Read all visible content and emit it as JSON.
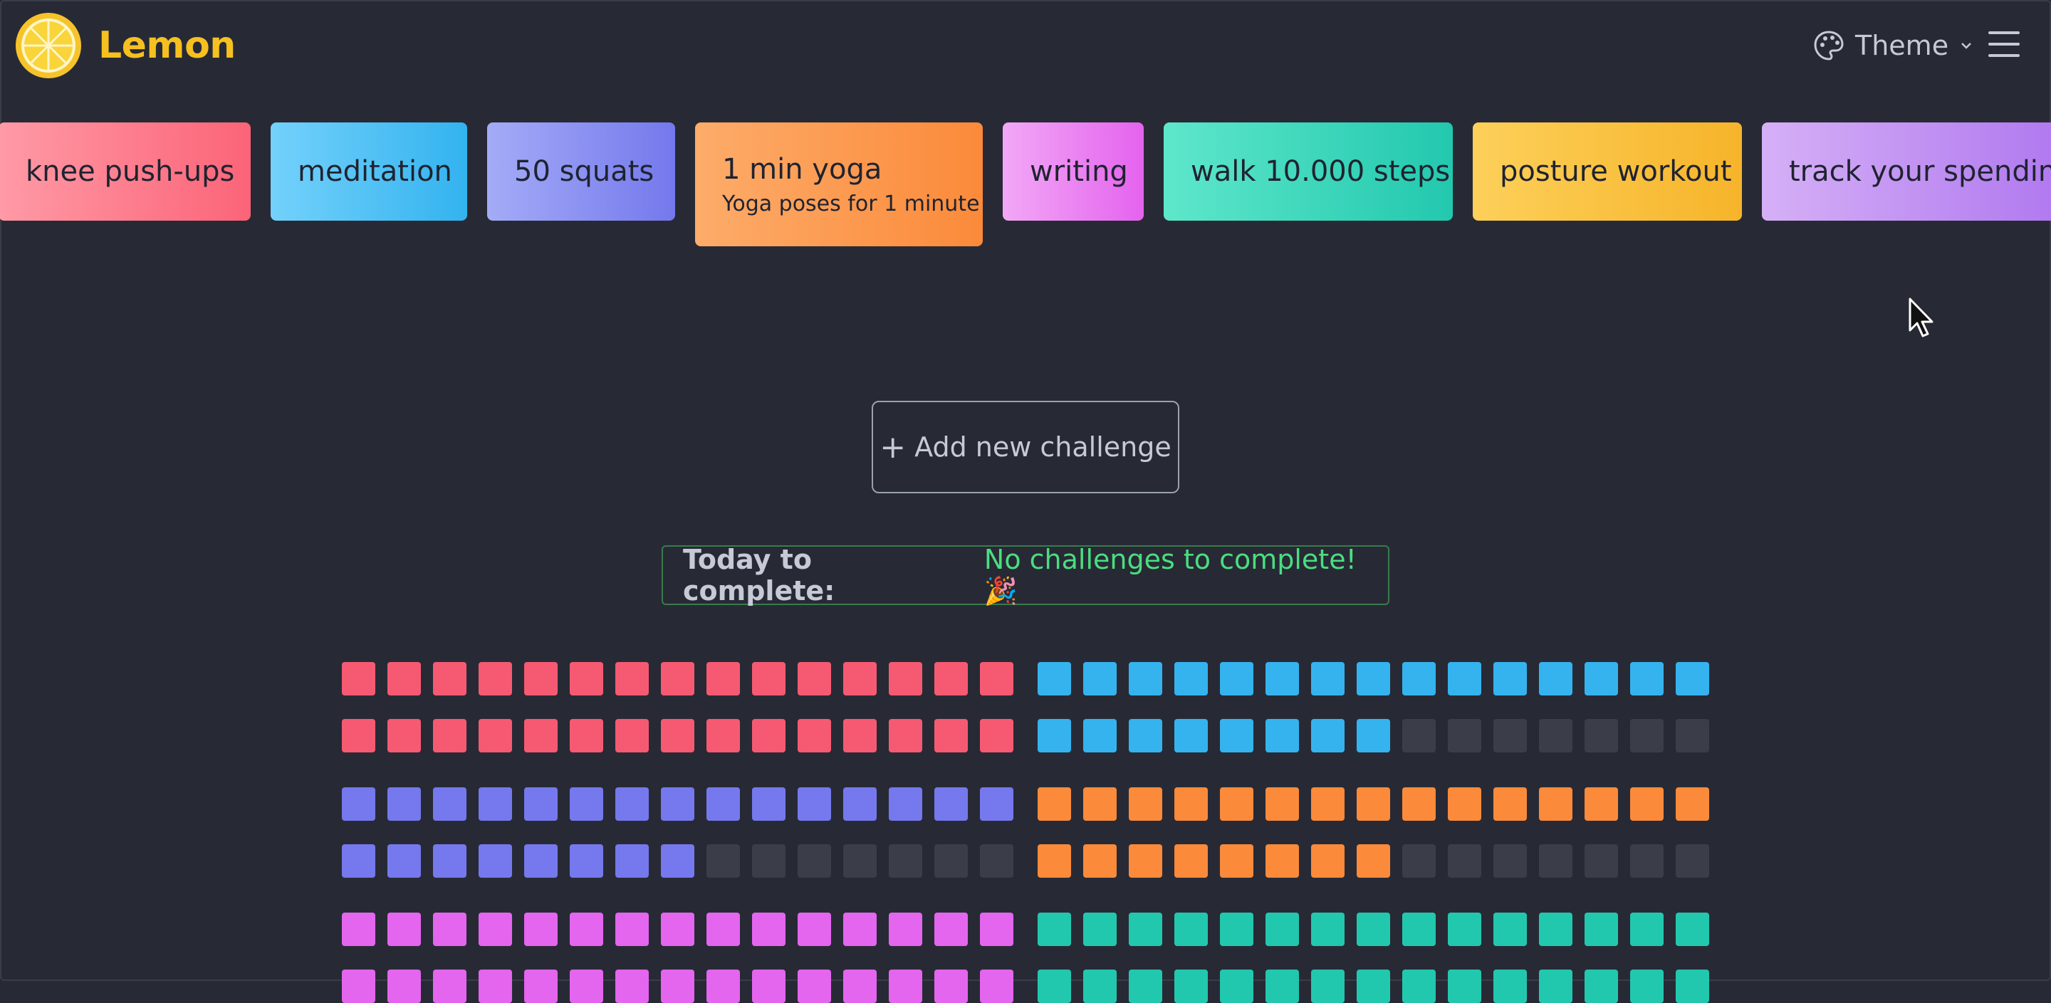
{
  "app": {
    "name": "Lemon",
    "theme_label": "Theme"
  },
  "challenges": [
    {
      "title": "knee push-ups",
      "subtitle": "",
      "color_from": "#ff9aa6",
      "color_to": "#fb6478"
    },
    {
      "title": "meditation",
      "subtitle": "",
      "color_from": "#74d1fb",
      "color_to": "#33b3ef"
    },
    {
      "title": "50 squats",
      "subtitle": "",
      "color_from": "#a4acf7",
      "color_to": "#7478ec"
    },
    {
      "title": "1 min yoga",
      "subtitle": "Yoga poses for 1 minute",
      "color_from": "#fdac6a",
      "color_to": "#fb8a3a"
    },
    {
      "title": "writing",
      "subtitle": "",
      "color_from": "#f2a8f6",
      "color_to": "#e463ee"
    },
    {
      "title": "walk 10.000 steps",
      "subtitle": "",
      "color_from": "#5ee7cb",
      "color_to": "#22c8ae"
    },
    {
      "title": "posture workout",
      "subtitle": "",
      "color_from": "#fdd05a",
      "color_to": "#f6b42a"
    },
    {
      "title": "track your spending",
      "subtitle": "",
      "color_from": "#d5b0f6",
      "color_to": "#b078ef"
    }
  ],
  "add_button": {
    "label": "Add new challenge"
  },
  "today": {
    "label": "Today to complete:",
    "message": "No challenges to complete! 🎉"
  },
  "progress": [
    {
      "challenge": "knee push-ups",
      "color": "#f65a72",
      "done": 30,
      "total": 30
    },
    {
      "challenge": "meditation",
      "color": "#35b3ef",
      "done": 23,
      "total": 30
    },
    {
      "challenge": "50 squats",
      "color": "#7579ed",
      "done": 23,
      "total": 30
    },
    {
      "challenge": "1 min yoga",
      "color": "#fb8a3a",
      "done": 23,
      "total": 30
    },
    {
      "challenge": "writing",
      "color": "#e465ee",
      "done": 30,
      "total": 30
    },
    {
      "challenge": "walk 10.000 steps",
      "color": "#22c8ae",
      "done": 30,
      "total": 30
    }
  ],
  "colors": {
    "background": "#272a35",
    "empty_cell": "#3b3e49",
    "brand": "#f5c020",
    "success": "#4ade80"
  },
  "icons": {
    "logo": "lemon-logo-icon",
    "theme": "palette-icon",
    "menu": "hamburger-menu-icon",
    "add": "plus-icon"
  }
}
